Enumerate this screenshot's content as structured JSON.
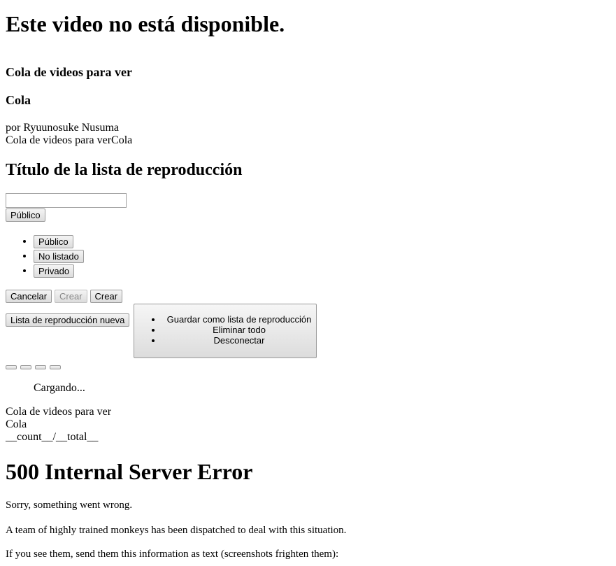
{
  "unavailable_title": "Este video no está disponible.",
  "queue": {
    "heading": "Cola de videos para ver",
    "subheading": "Cola",
    "author": "por Ryuunosuke Nusuma",
    "combined": "Cola de videos para verCola"
  },
  "playlist_form": {
    "title_heading": "Título de la lista de reproducción",
    "title_input_value": "",
    "privacy_button": "Público",
    "privacy_options": [
      "Público",
      "No listado",
      "Privado"
    ],
    "cancel_button": "Cancelar",
    "create_button_disabled": "Crear",
    "create_button": "Crear"
  },
  "toolbar": {
    "new_playlist_button": "Lista de reproducción nueva",
    "menu_items": [
      "Guardar como lista de reproducción",
      "Eliminar todo",
      "Desconectar"
    ]
  },
  "loading_text": "Cargando...",
  "queue_footer": {
    "line1": "Cola de videos para ver",
    "line2": "Cola",
    "counter": "__count__/__total__"
  },
  "error": {
    "title": "500 Internal Server Error",
    "line1": "Sorry, something went wrong.",
    "line2": "A team of highly trained monkeys has been dispatched to deal with this situation.",
    "line3": "If you see them, send them this information as text (screenshots frighten them):"
  }
}
